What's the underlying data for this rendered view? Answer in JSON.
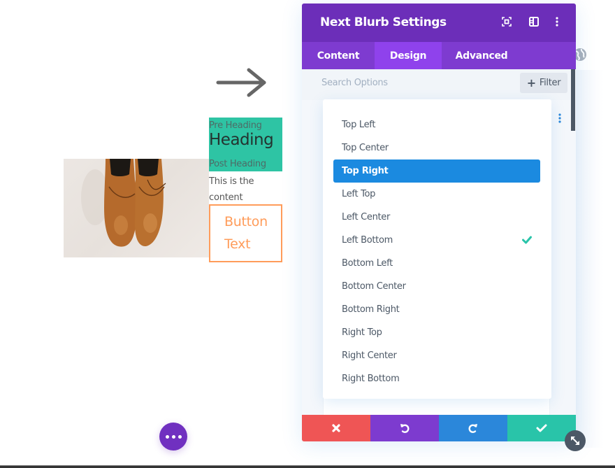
{
  "canvas": {
    "blurb": {
      "pre_heading": "Pre Heading",
      "heading": "Heading",
      "post_heading": "Post Heading",
      "content_line1": "This is the",
      "content_line2": "content",
      "button_line1": "Button",
      "button_line2": "Text",
      "image_alt": "brown leather shoes hanging"
    },
    "arrow_icon": "arrow-right-icon",
    "fab_icon": "more-horizontal-icon"
  },
  "modal": {
    "title": "Next Blurb Settings",
    "header_icons": [
      "focus-icon",
      "split-view-icon",
      "more-vertical-icon"
    ],
    "tabs": [
      {
        "label": "Content",
        "active": false
      },
      {
        "label": "Design",
        "active": true
      },
      {
        "label": "Advanced",
        "active": false
      }
    ],
    "search": {
      "placeholder": "Search Options",
      "value": ""
    },
    "filter": {
      "label": "Filter",
      "icon": "plus-icon"
    },
    "dropdown": {
      "items": [
        {
          "label": "Top Left",
          "highlighted": false,
          "checked": false
        },
        {
          "label": "Top Center",
          "highlighted": false,
          "checked": false
        },
        {
          "label": "Top Right",
          "highlighted": true,
          "checked": false
        },
        {
          "label": "Left Top",
          "highlighted": false,
          "checked": false
        },
        {
          "label": "Left Center",
          "highlighted": false,
          "checked": false
        },
        {
          "label": "Left Bottom",
          "highlighted": false,
          "checked": true
        },
        {
          "label": "Bottom Left",
          "highlighted": false,
          "checked": false
        },
        {
          "label": "Bottom Center",
          "highlighted": false,
          "checked": false
        },
        {
          "label": "Bottom Right",
          "highlighted": false,
          "checked": false
        },
        {
          "label": "Right Top",
          "highlighted": false,
          "checked": false
        },
        {
          "label": "Right Center",
          "highlighted": false,
          "checked": false
        },
        {
          "label": "Right Bottom",
          "highlighted": false,
          "checked": false
        }
      ]
    },
    "footer": {
      "cancel_icon": "close-icon",
      "undo_icon": "undo-icon",
      "redo_icon": "redo-icon",
      "save_icon": "checkmark-icon"
    }
  },
  "colors": {
    "header_purple": "#6c2eb9",
    "tab_purple": "#7e3bd0",
    "tab_active": "#8f42ec",
    "selected_blue": "#1b8ae0",
    "check_teal": "#29c4a9",
    "cancel_red": "#ef5555",
    "redo_blue": "#2b87da",
    "heading_teal": "#2ec4a4",
    "button_orange": "#ff9c5a"
  }
}
